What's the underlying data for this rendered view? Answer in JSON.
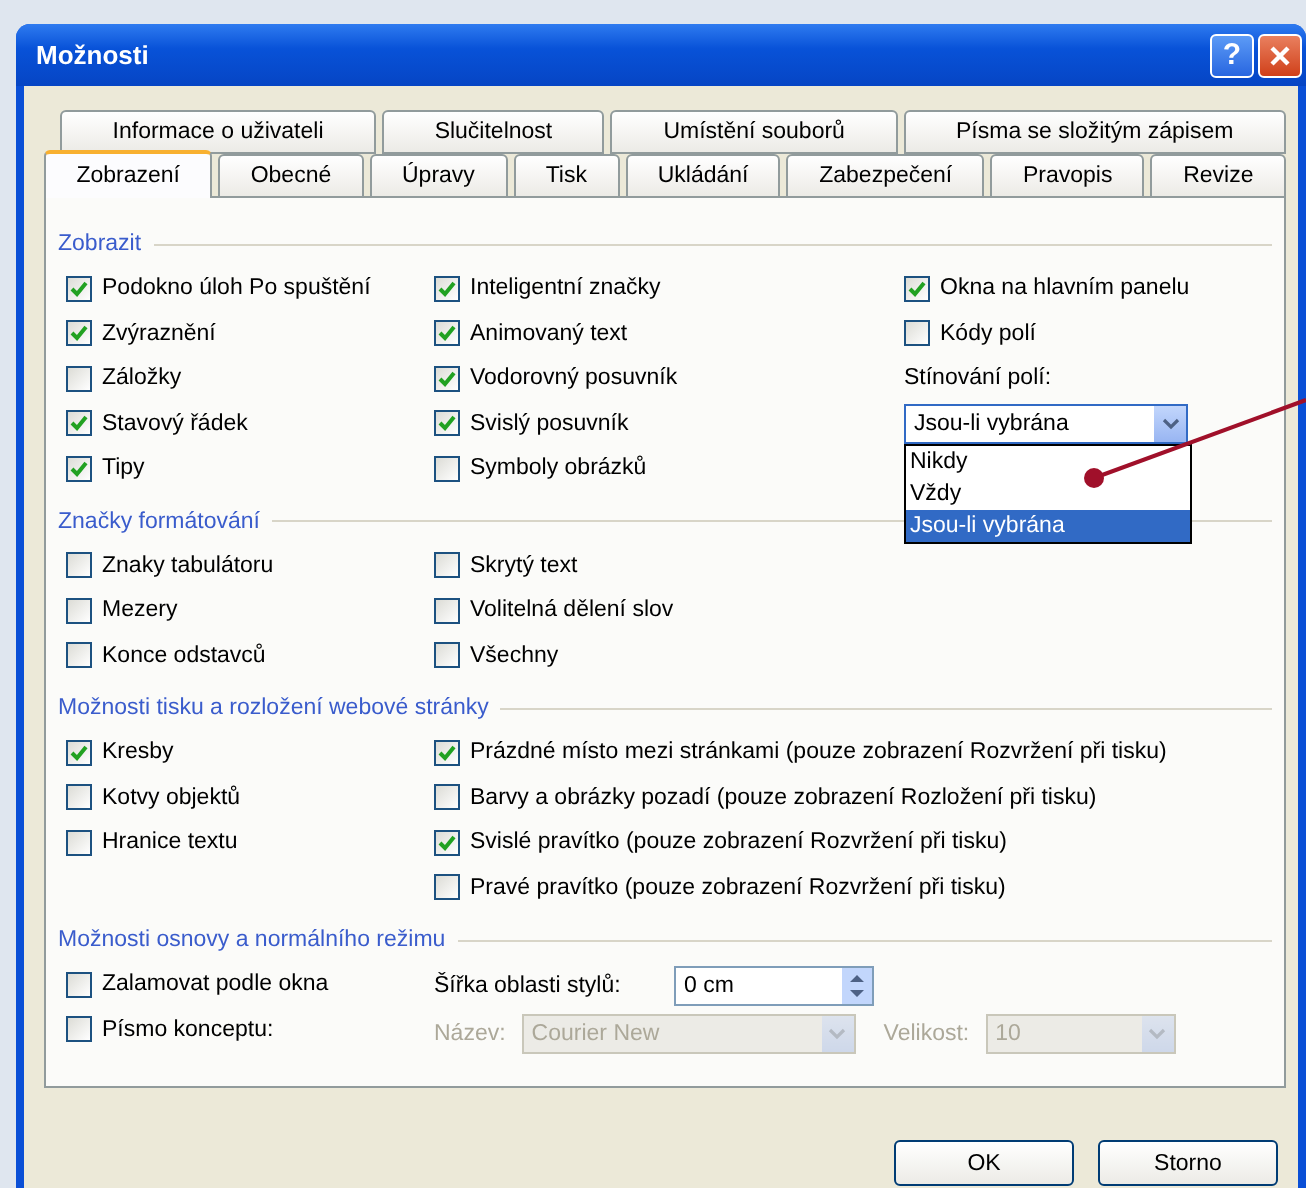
{
  "window": {
    "title": "Možnosti",
    "help": "?"
  },
  "tab_rows": [
    [
      {
        "label": "Informace o uživateli",
        "selected": false
      },
      {
        "label": "Slučitelnost",
        "selected": false
      },
      {
        "label": "Umístění souborů",
        "selected": false
      },
      {
        "label": "Písma se složitým zápisem",
        "selected": false
      }
    ],
    [
      {
        "label": "Zobrazení",
        "selected": true
      },
      {
        "label": "Obecné",
        "selected": false
      },
      {
        "label": "Úpravy",
        "selected": false
      },
      {
        "label": "Tisk",
        "selected": false
      },
      {
        "label": "Ukládání",
        "selected": false
      },
      {
        "label": "Zabezpečení",
        "selected": false
      },
      {
        "label": "Pravopis",
        "selected": false
      },
      {
        "label": "Revize",
        "selected": false
      }
    ]
  ],
  "sections": [
    {
      "title": "Zobrazit",
      "columns": [
        [
          {
            "kind": "checkbox",
            "label": "Podokno úloh Po spuštění",
            "checked": true
          },
          {
            "kind": "checkbox",
            "label": "Zvýraznění",
            "checked": true
          },
          {
            "kind": "checkbox",
            "label": "Záložky",
            "checked": false
          },
          {
            "kind": "checkbox",
            "label": "Stavový řádek",
            "checked": true
          },
          {
            "kind": "checkbox",
            "label": "Tipy",
            "checked": true
          }
        ],
        [
          {
            "kind": "checkbox",
            "label": "Inteligentní značky",
            "checked": true
          },
          {
            "kind": "checkbox",
            "label": "Animovaný text",
            "checked": true
          },
          {
            "kind": "checkbox",
            "label": "Vodorovný posuvník",
            "checked": true
          },
          {
            "kind": "checkbox",
            "label": "Svislý posuvník",
            "checked": true
          },
          {
            "kind": "checkbox",
            "label": "Symboly obrázků",
            "checked": false
          }
        ],
        [
          {
            "kind": "checkbox",
            "label": "Okna na hlavním panelu",
            "checked": true
          },
          {
            "kind": "checkbox",
            "label": "Kódy polí",
            "checked": false
          },
          {
            "kind": "label",
            "label": "Stínování polí:"
          },
          {
            "kind": "dropdown",
            "value": "Jsou-li vybrána",
            "expanded": true,
            "options": [
              {
                "label": "Nikdy",
                "selected": false
              },
              {
                "label": "Vždy",
                "selected": false
              },
              {
                "label": "Jsou-li vybrána",
                "selected": true
              }
            ]
          }
        ]
      ]
    },
    {
      "title": "Značky formátování",
      "columns": [
        [
          {
            "kind": "checkbox",
            "label": "Znaky tabulátoru",
            "checked": false
          },
          {
            "kind": "checkbox",
            "label": "Mezery",
            "checked": false
          },
          {
            "kind": "checkbox",
            "label": "Konce odstavců",
            "checked": false
          }
        ],
        [
          {
            "kind": "checkbox",
            "label": "Skrytý text",
            "checked": false
          },
          {
            "kind": "checkbox",
            "label": "Volitelná dělení slov",
            "checked": false
          },
          {
            "kind": "checkbox",
            "label": "Všechny",
            "checked": false
          }
        ]
      ]
    },
    {
      "title": "Možnosti tisku a rozložení webové stránky",
      "columns": [
        [
          {
            "kind": "checkbox",
            "label": "Kresby",
            "checked": true
          },
          {
            "kind": "checkbox",
            "label": "Kotvy objektů",
            "checked": false
          },
          {
            "kind": "checkbox",
            "label": "Hranice textu",
            "checked": false
          }
        ],
        [
          {
            "kind": "checkbox",
            "label": "Prázdné místo mezi stránkami (pouze zobrazení Rozvržení při tisku)",
            "checked": true
          },
          {
            "kind": "checkbox",
            "label": "Barvy a obrázky pozadí (pouze zobrazení Rozložení při tisku)",
            "checked": false
          },
          {
            "kind": "checkbox",
            "label": "Svislé pravítko (pouze zobrazení Rozvržení při tisku)",
            "checked": true
          },
          {
            "kind": "checkbox",
            "label": "Pravé pravítko (pouze zobrazení Rozvržení při tisku)",
            "checked": false
          }
        ]
      ]
    },
    {
      "title": "Možnosti osnovy a normálního režimu",
      "columns": [
        [
          {
            "kind": "checkbox",
            "label": "Zalamovat podle okna",
            "checked": false
          },
          {
            "kind": "checkbox",
            "label": "Písmo konceptu:",
            "checked": false
          }
        ],
        [
          {
            "kind": "spin",
            "label": "Šířka oblasti stylů:",
            "value": "0 cm"
          },
          {
            "kind": "select-pair",
            "fields": [
              {
                "label": "Název:",
                "value": "Courier New",
                "disabled": true
              },
              {
                "label": "Velikost:",
                "value": "10",
                "disabled": true
              }
            ]
          }
        ]
      ]
    }
  ],
  "buttons": [
    "OK",
    "Storno"
  ]
}
